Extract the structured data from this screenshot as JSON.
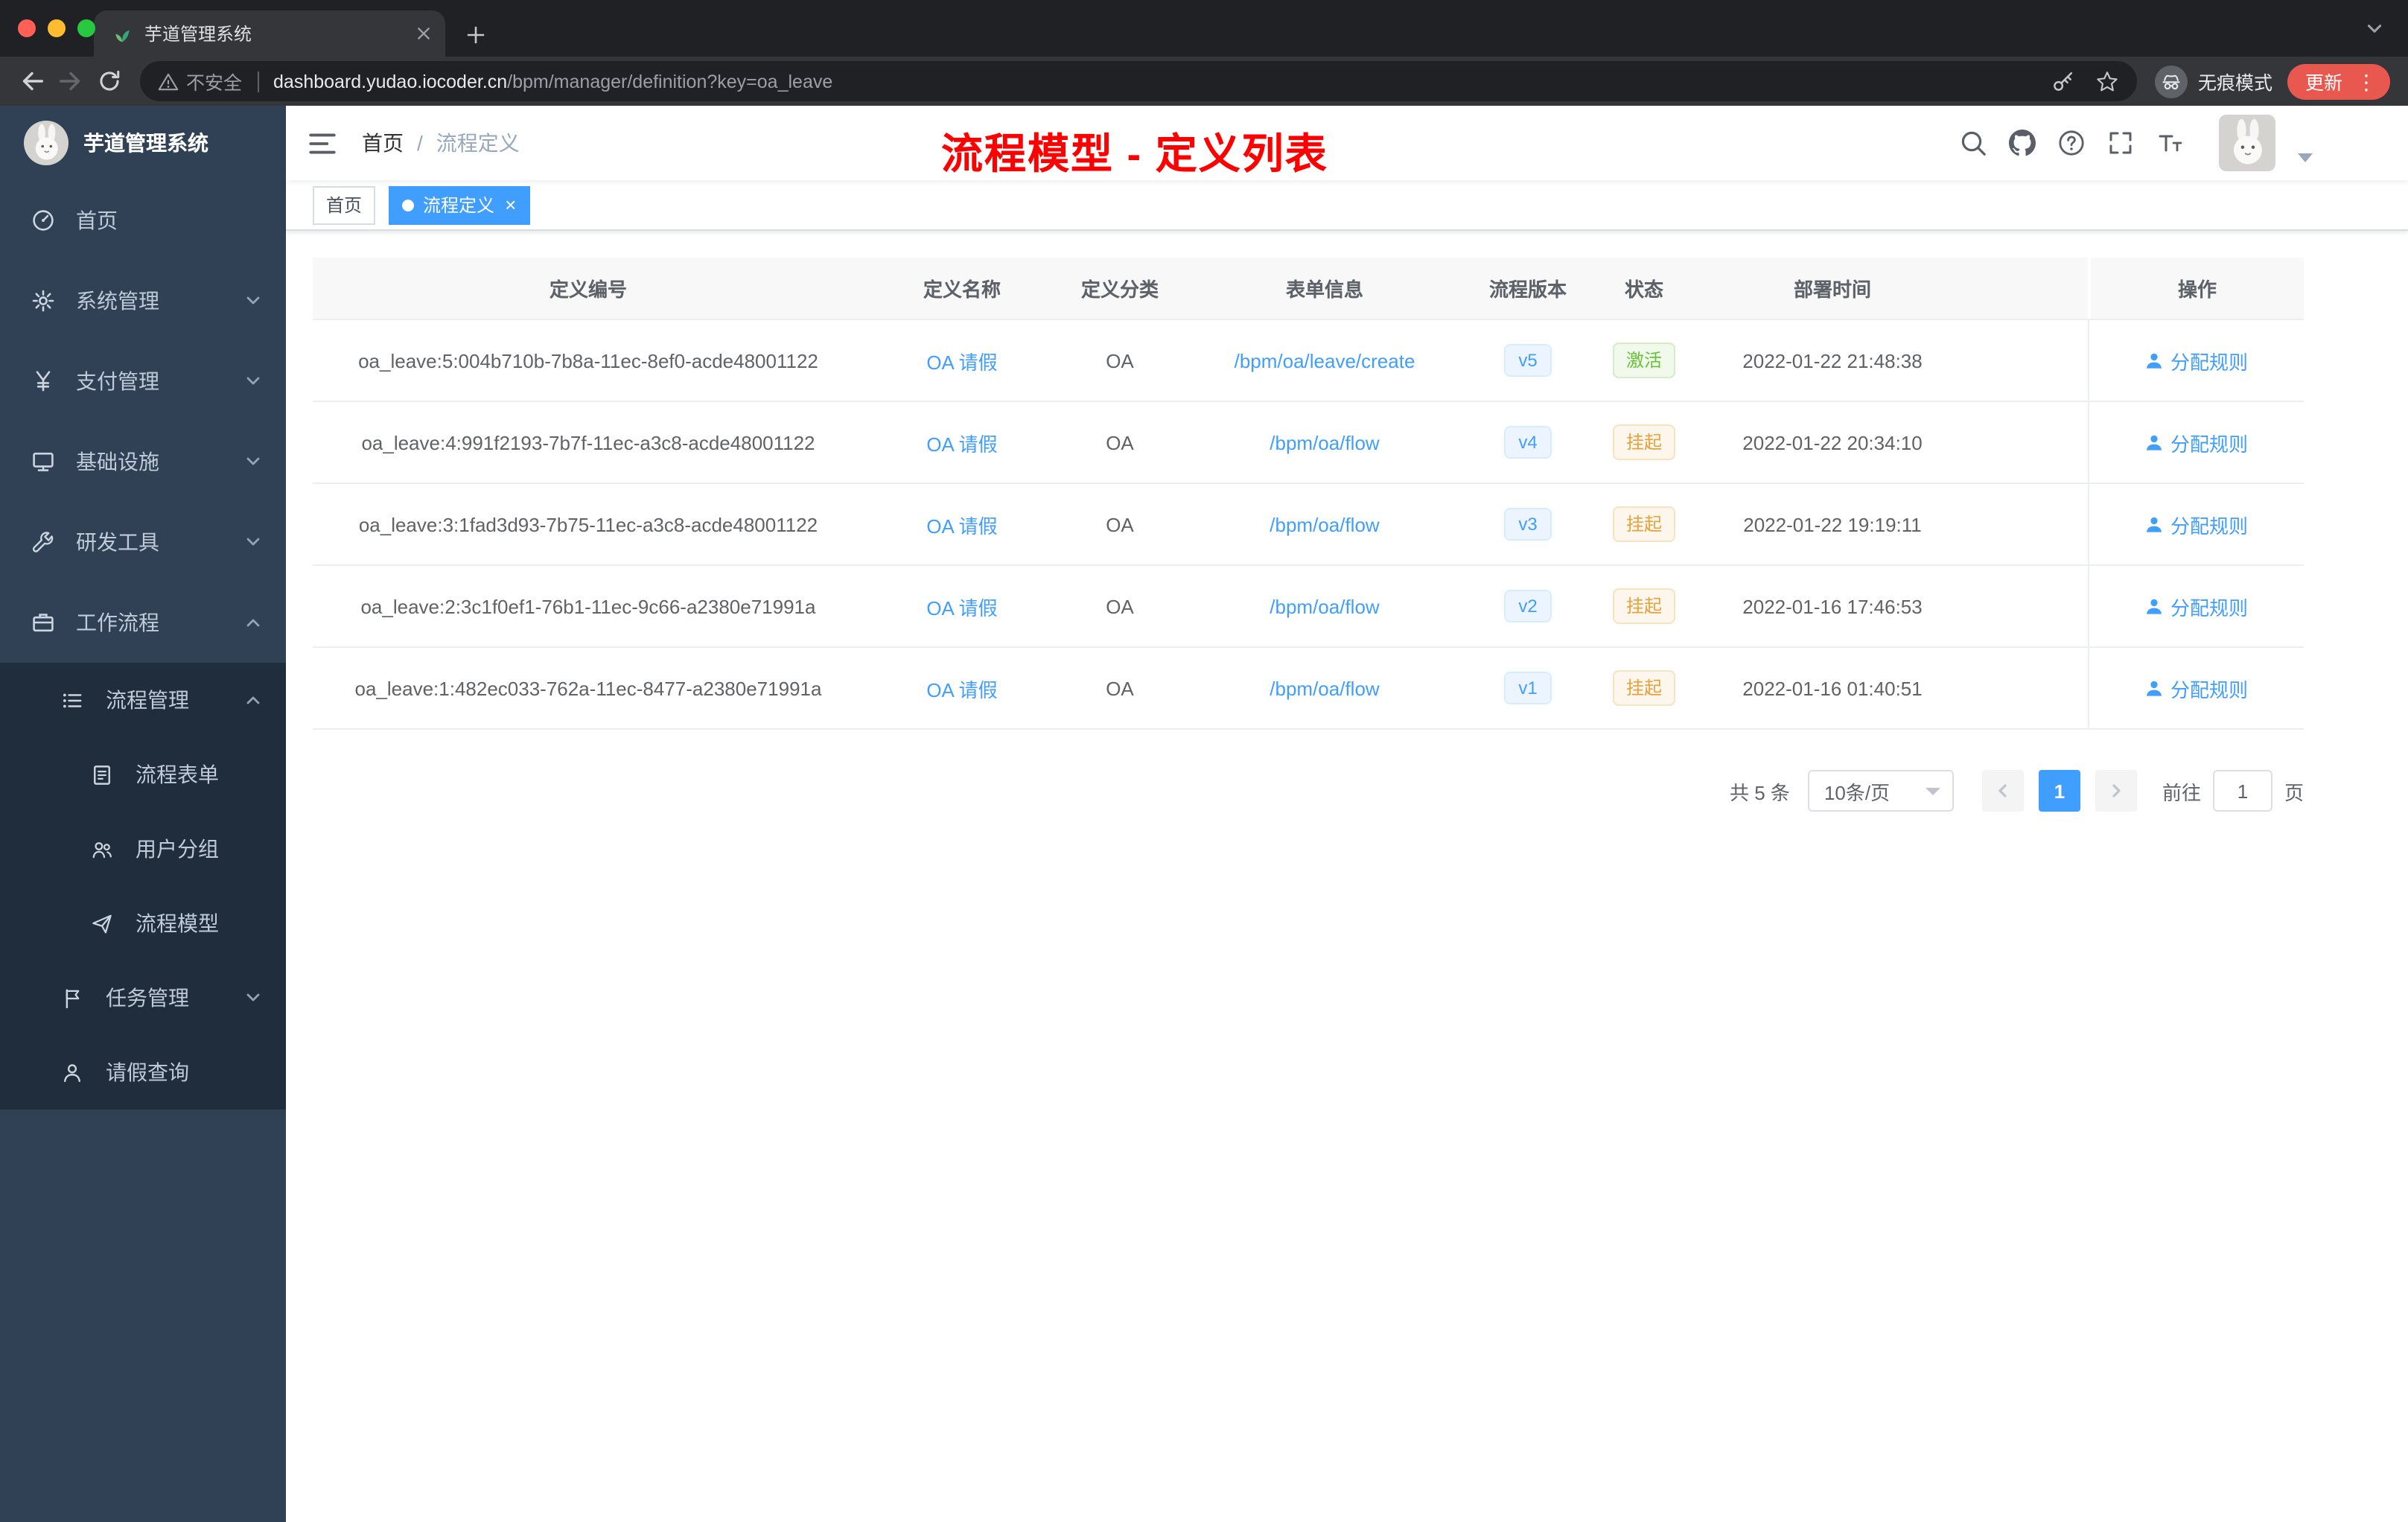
{
  "colors": {
    "accent": "#409eff",
    "success": "#67c23a",
    "warning": "#e6a23c",
    "annotation_red": "#ff0000",
    "sidebar_bg": "#304156",
    "submenu_bg": "#1f2d3d"
  },
  "browser": {
    "tab_title": "芋道管理系统",
    "security_label": "不安全",
    "url_domain": "dashboard.yudao.iocoder.cn",
    "url_path": "/bpm/manager/definition?key=oa_leave",
    "incognito_label": "无痕模式",
    "update_label": "更新"
  },
  "sidebar": {
    "logo_title": "芋道管理系统",
    "items": [
      {
        "label": "首页"
      },
      {
        "label": "系统管理"
      },
      {
        "label": "支付管理"
      },
      {
        "label": "基础设施"
      },
      {
        "label": "研发工具"
      },
      {
        "label": "工作流程"
      }
    ],
    "submenu": [
      {
        "label": "流程管理"
      },
      {
        "label": "流程表单"
      },
      {
        "label": "用户分组"
      },
      {
        "label": "流程模型"
      },
      {
        "label": "任务管理"
      },
      {
        "label": "请假查询"
      }
    ]
  },
  "navbar": {
    "breadcrumb_home": "首页",
    "breadcrumb_sep": "/",
    "breadcrumb_current": "流程定义",
    "annotation": "流程模型 - 定义列表"
  },
  "tags": {
    "home": "首页",
    "current": "流程定义"
  },
  "table": {
    "columns": {
      "id": "定义编号",
      "name": "定义名称",
      "category": "定义分类",
      "form": "表单信息",
      "version": "流程版本",
      "status": "状态",
      "time": "部署时间",
      "action": "操作"
    },
    "rows": [
      {
        "id": "oa_leave:5:004b710b-7b8a-11ec-8ef0-acde48001122",
        "name": "OA 请假",
        "category": "OA",
        "form": "/bpm/oa/leave/create",
        "version": "v5",
        "status": "激活",
        "status_type": "success",
        "time": "2022-01-22 21:48:38",
        "action": "分配规则"
      },
      {
        "id": "oa_leave:4:991f2193-7b7f-11ec-a3c8-acde48001122",
        "name": "OA 请假",
        "category": "OA",
        "form": "/bpm/oa/flow",
        "version": "v4",
        "status": "挂起",
        "status_type": "warning",
        "time": "2022-01-22 20:34:10",
        "action": "分配规则"
      },
      {
        "id": "oa_leave:3:1fad3d93-7b75-11ec-a3c8-acde48001122",
        "name": "OA 请假",
        "category": "OA",
        "form": "/bpm/oa/flow",
        "version": "v3",
        "status": "挂起",
        "status_type": "warning",
        "time": "2022-01-22 19:19:11",
        "action": "分配规则"
      },
      {
        "id": "oa_leave:2:3c1f0ef1-76b1-11ec-9c66-a2380e71991a",
        "name": "OA 请假",
        "category": "OA",
        "form": "/bpm/oa/flow",
        "version": "v2",
        "status": "挂起",
        "status_type": "warning",
        "time": "2022-01-16 17:46:53",
        "action": "分配规则"
      },
      {
        "id": "oa_leave:1:482ec033-762a-11ec-8477-a2380e71991a",
        "name": "OA 请假",
        "category": "OA",
        "form": "/bpm/oa/flow",
        "version": "v1",
        "status": "挂起",
        "status_type": "warning",
        "time": "2022-01-16 01:40:51",
        "action": "分配规则"
      }
    ]
  },
  "pagination": {
    "total": "共 5 条",
    "page_size": "10条/页",
    "current_page": "1",
    "goto": "前往",
    "goto_value": "1",
    "page_unit": "页"
  }
}
